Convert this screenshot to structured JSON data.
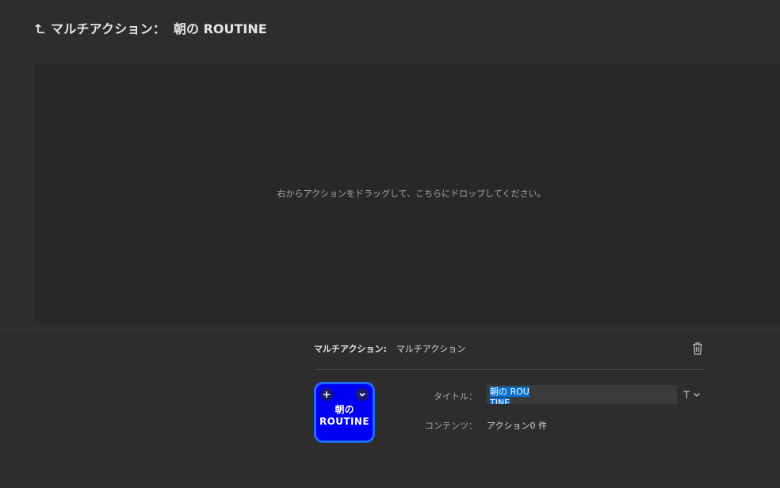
{
  "header": {
    "prefix": "マルチアクション：",
    "name": "朝の ROUTINE"
  },
  "drop_area": {
    "hint": "右からアクションをドラッグして、こちらにドロップしてください。"
  },
  "properties": {
    "label": "マルチアクション:",
    "value": "マルチアクション"
  },
  "tile": {
    "line1": "朝の",
    "line2": "ROUTINE",
    "add_glyph": "+",
    "background_color": "#0000f2",
    "border_color": "#1e6bff"
  },
  "fields": {
    "title_label": "タイトル：",
    "title_value": "朝の ROUTINE",
    "content_label": "コンテンツ：",
    "content_value": "アクション0 件"
  },
  "font_button": {
    "glyph": "T"
  },
  "icons": {
    "back": "back-up-arrow-icon",
    "trash": "trash-icon",
    "add": "plus-icon",
    "menu": "chevron-down-icon",
    "font": "text-format-icon"
  }
}
